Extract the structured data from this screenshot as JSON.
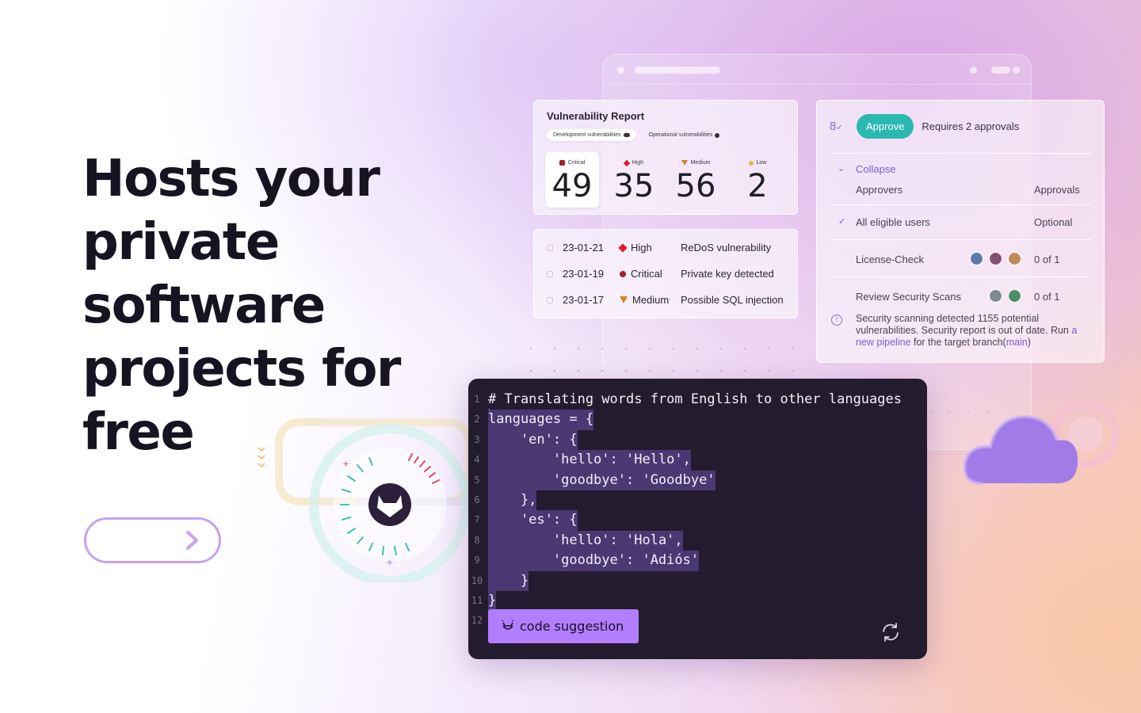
{
  "hero": {
    "headline_line1": "Hosts your",
    "headline_line2": "private software",
    "headline_line3": "projects for free"
  },
  "vulnerability_report": {
    "title": "Vulnerability Report",
    "tabs": [
      {
        "label": "Development vulnerabilities",
        "active": true
      },
      {
        "label": "Operational vulnerabilities",
        "active": false
      }
    ],
    "severities": [
      {
        "label": "Critical",
        "count": "49",
        "icon": "critical-hexagon-icon",
        "color": "#a31d24"
      },
      {
        "label": "High",
        "count": "35",
        "icon": "high-diamond-icon",
        "color": "#dd1f2a"
      },
      {
        "label": "Medium",
        "count": "56",
        "icon": "medium-triangle-icon",
        "color": "#d9802d"
      },
      {
        "label": "Low",
        "count": "2",
        "icon": "low-circle-icon",
        "color": "#e9b53e"
      }
    ]
  },
  "vulnerability_list": [
    {
      "date": "23-01-21",
      "severity": "High",
      "description": "ReDoS vulnerability"
    },
    {
      "date": "23-01-19",
      "severity": "Critical",
      "description": "Private key detected"
    },
    {
      "date": "23-01-17",
      "severity": "Medium",
      "description": "Possible SQL injection"
    }
  ],
  "approvals": {
    "approve_label": "Approve",
    "requires_text": "Requires 2 approvals",
    "collapse_label": "Collapse",
    "col_approvers": "Approvers",
    "col_approvals": "Approvals",
    "rows": [
      {
        "name": "All eligible users",
        "status": "Optional"
      },
      {
        "name": "License-Check",
        "status": "0 of 1"
      },
      {
        "name": "Review Security Scans",
        "status": "0 of 1"
      }
    ],
    "warning_prefix": "Security scanning detected 1155 potential vulnerabilities. Security report is out of date. Run ",
    "warning_link": "a new pipeline",
    "warning_middle": " for the target branch(",
    "warning_branch": "main",
    "warning_suffix": ")",
    "accent_color": "#2bb8b0"
  },
  "code_editor": {
    "lines": [
      {
        "n": "1",
        "text": "# Translating words from English to other languages"
      },
      {
        "n": "2",
        "text": "languages = {"
      },
      {
        "n": "3",
        "text": "    'en': {"
      },
      {
        "n": "4",
        "text": "        'hello': 'Hello',"
      },
      {
        "n": "5",
        "text": "        'goodbye': 'Goodbye'"
      },
      {
        "n": "6",
        "text": "    },"
      },
      {
        "n": "7",
        "text": "    'es': {"
      },
      {
        "n": "8",
        "text": "        'hello': 'Hola',"
      },
      {
        "n": "9",
        "text": "        'goodbye': 'Adiós'"
      },
      {
        "n": "10",
        "text": "    }"
      },
      {
        "n": "11",
        "text": "}"
      },
      {
        "n": "12",
        "text": ""
      }
    ],
    "suggestion_label": "code suggestion",
    "background": "#231c2e",
    "highlight": "#4a3873",
    "button_color": "#b27dff"
  }
}
